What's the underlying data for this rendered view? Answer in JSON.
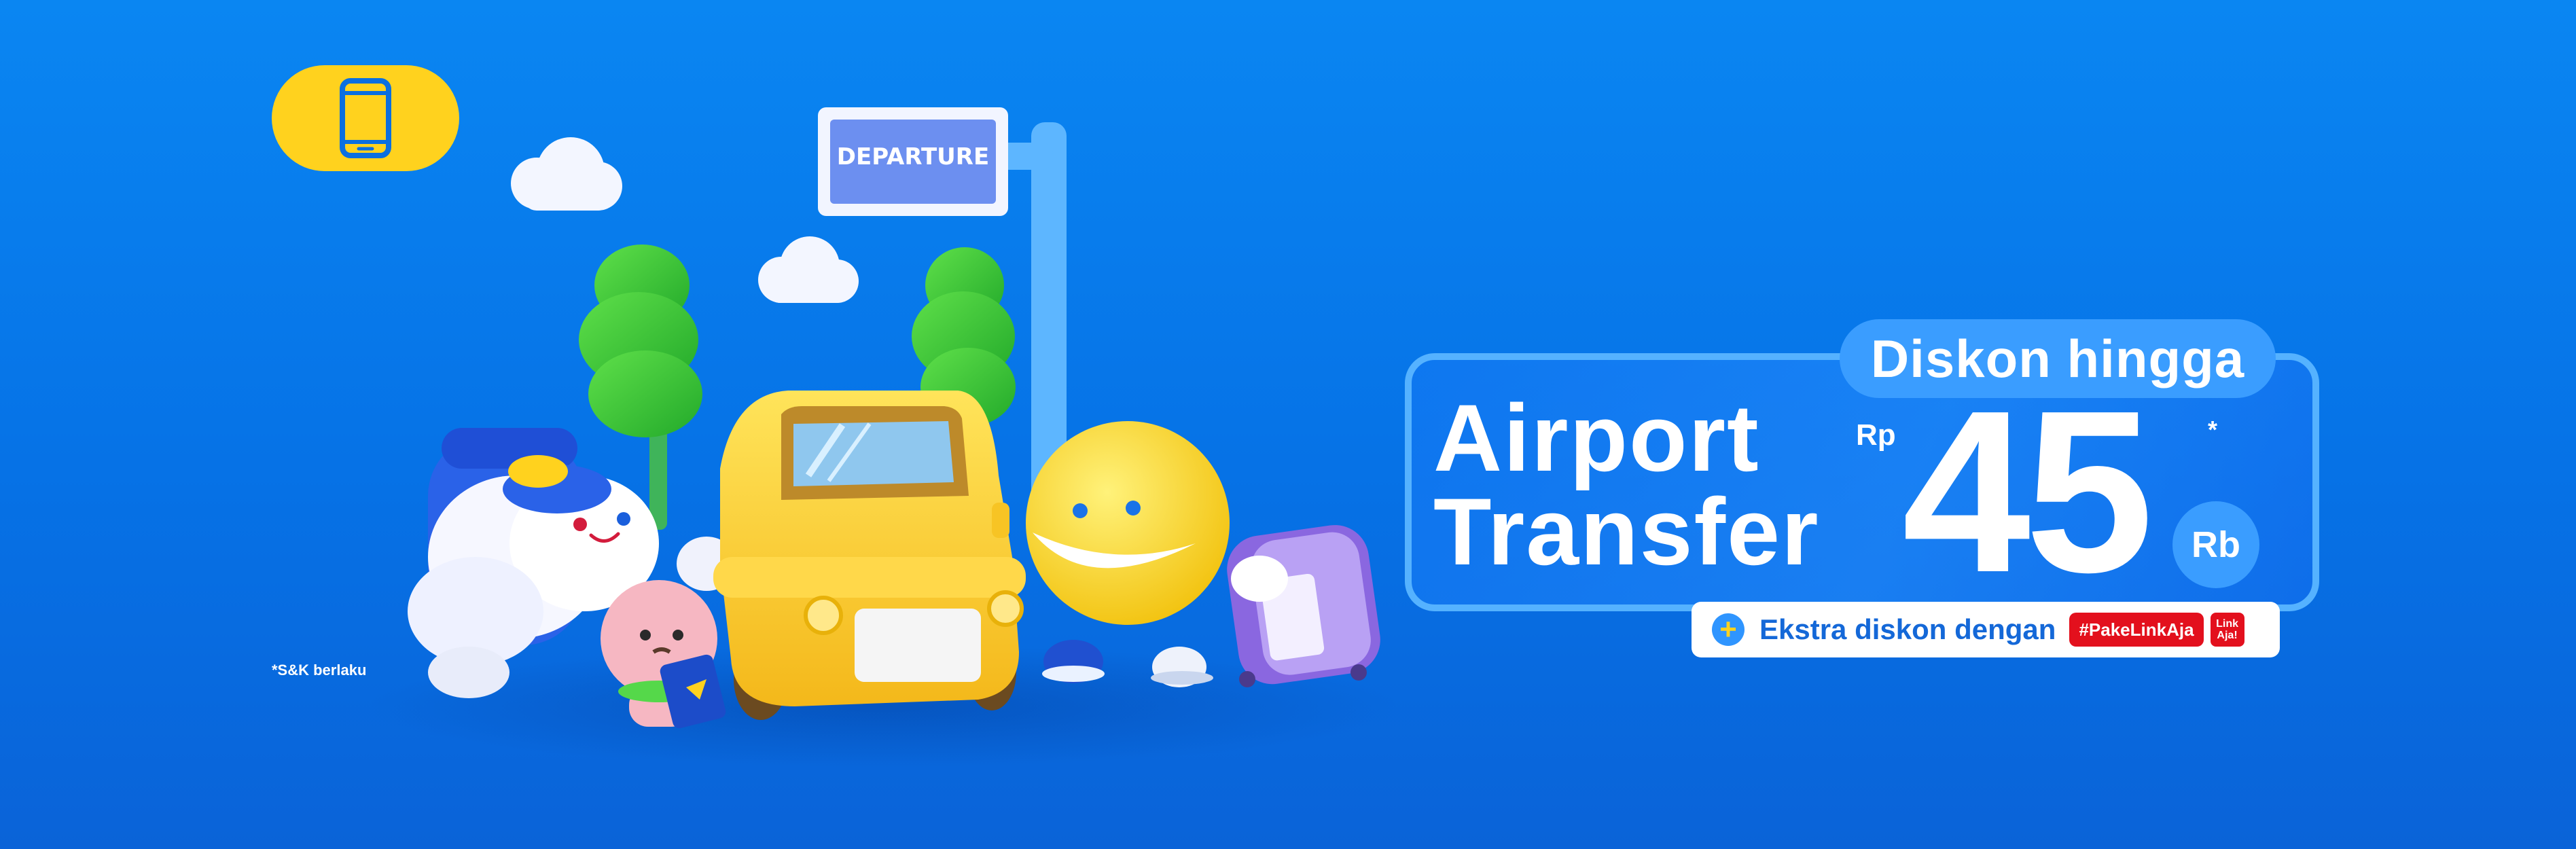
{
  "badge": {
    "icon": "smartphone-icon"
  },
  "scene": {
    "sign_text": "DEPARTURE"
  },
  "promo": {
    "headline_pill": "Diskon hingga",
    "title_line1": "Airport",
    "title_line2": "Transfer",
    "currency": "Rp",
    "amount": "45",
    "asterisk": "*",
    "unit": "Rb",
    "extra_text": "Ekstra diskon dengan",
    "hashtag": "#PakeLinkAja",
    "logo_text": "Link Aja!"
  },
  "footnote": "*S&K berlaku",
  "colors": {
    "background": "#0672e6",
    "accent_yellow": "#ffd21e",
    "pill_blue": "#3a9dff",
    "linkaja_red": "#e3101d"
  }
}
